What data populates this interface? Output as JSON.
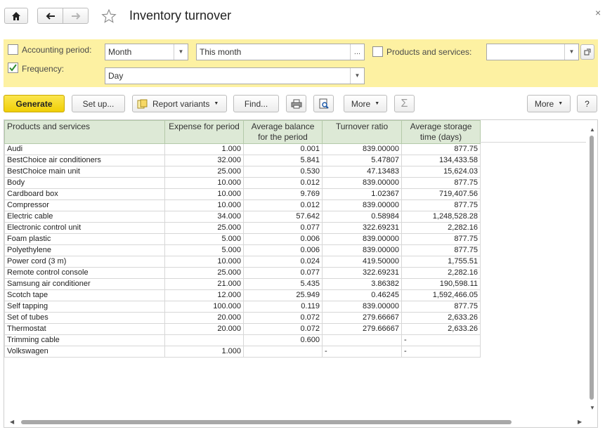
{
  "window": {
    "title": "Inventory turnover",
    "close_label": "×"
  },
  "nav": {
    "home_icon": "home-icon",
    "back_icon": "arrow-left-icon",
    "forward_icon": "arrow-right-icon",
    "favorite_icon": "star-icon"
  },
  "settings": {
    "accounting_period": {
      "label": "Accounting period:",
      "checked": false,
      "period_type": "Month",
      "period_value": "This month"
    },
    "frequency": {
      "label": "Frequency:",
      "checked": true,
      "value": "Day"
    },
    "products": {
      "label": "Products and services:",
      "checked": false,
      "value": ""
    },
    "ellipsis": "..."
  },
  "toolbar": {
    "generate": "Generate",
    "setup": "Set up...",
    "report_variants": "Report variants",
    "find": "Find...",
    "more": "More",
    "more_right": "More",
    "help": "?",
    "sum_symbol": "Σ"
  },
  "table": {
    "headers": [
      "Products and services",
      "Expense for period",
      "Average balance for the period",
      "Turnover ratio",
      "Average storage time (days)"
    ],
    "rows": [
      [
        "Audi",
        "1.000",
        "0.001",
        "839.00000",
        "877.75"
      ],
      [
        "BestChoice air conditioners",
        "32.000",
        "5.841",
        "5.47807",
        "134,433.58"
      ],
      [
        "BestChoice main unit",
        "25.000",
        "0.530",
        "47.13483",
        "15,624.03"
      ],
      [
        "Body",
        "10.000",
        "0.012",
        "839.00000",
        "877.75"
      ],
      [
        "Cardboard box",
        "10.000",
        "9.769",
        "1.02367",
        "719,407.56"
      ],
      [
        "Compressor",
        "10.000",
        "0.012",
        "839.00000",
        "877.75"
      ],
      [
        "Electric cable",
        "34.000",
        "57.642",
        "0.58984",
        "1,248,528.28"
      ],
      [
        "Electronic control unit",
        "25.000",
        "0.077",
        "322.69231",
        "2,282.16"
      ],
      [
        "Foam plastic",
        "5.000",
        "0.006",
        "839.00000",
        "877.75"
      ],
      [
        "Polyethylene",
        "5.000",
        "0.006",
        "839.00000",
        "877.75"
      ],
      [
        "Power cord (3 m)",
        "10.000",
        "0.024",
        "419.50000",
        "1,755.51"
      ],
      [
        "Remote control console",
        "25.000",
        "0.077",
        "322.69231",
        "2,282.16"
      ],
      [
        "Samsung air conditioner",
        "21.000",
        "5.435",
        "3.86382",
        "190,598.11"
      ],
      [
        "Scotch tape",
        "12.000",
        "25.949",
        "0.46245",
        "1,592,466.05"
      ],
      [
        "Self tapping",
        "100.000",
        "0.119",
        "839.00000",
        "877.75"
      ],
      [
        "Set of tubes",
        "20.000",
        "0.072",
        "279.66667",
        "2,633.26"
      ],
      [
        "Thermostat",
        "20.000",
        "0.072",
        "279.66667",
        "2,633.26"
      ],
      [
        "Trimming cable",
        "",
        "0.600",
        "",
        "-"
      ],
      [
        "Volkswagen",
        "1.000",
        "",
        "-",
        "-"
      ]
    ]
  },
  "colors": {
    "accent_yellow": "#fdf1a2",
    "generate_button": "#f5d90a",
    "header_green": "#dde9d6"
  }
}
